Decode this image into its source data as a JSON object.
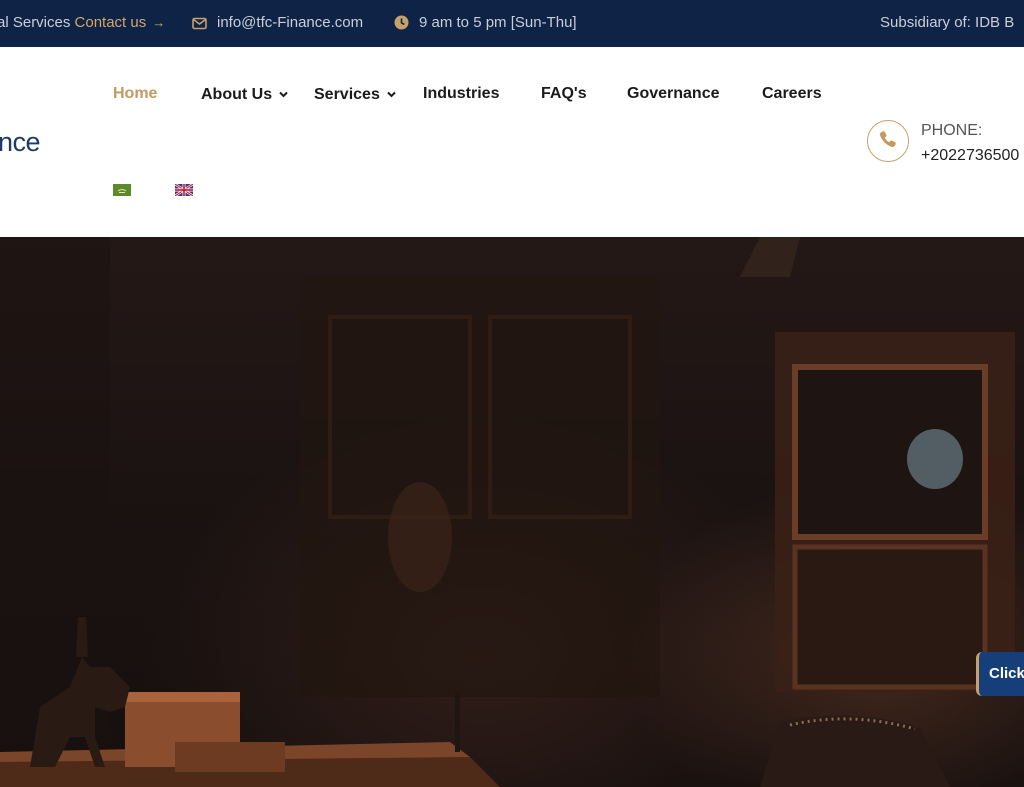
{
  "topbar": {
    "services_text": "al Services",
    "contact_label": "Contact us",
    "contact_arrow": "→",
    "email": "info@tfc-Finance.com",
    "hours": "9 am to 5 pm [Sun-Thu]",
    "subsidiary": "Subsidiary of: IDB B"
  },
  "header": {
    "logo_text": "nce",
    "nav": [
      {
        "label": "Home",
        "active": true
      },
      {
        "label": "About Us",
        "dropdown": true
      },
      {
        "label": "Services",
        "dropdown": true
      },
      {
        "label": "Industries"
      },
      {
        "label": "FAQ's"
      },
      {
        "label": "Governance"
      },
      {
        "label": "Careers"
      }
    ],
    "languages": [
      "arabic-flag",
      "uk-flag"
    ],
    "phone_label": "PHONE:",
    "phone_number": "+2022736500"
  },
  "hero": {
    "click_tab_label": "Click"
  },
  "colors": {
    "topbar_bg": "#0e2345",
    "accent_gold": "#c29a62",
    "logo_blue": "#1d3b6a",
    "click_tab_bg": "#163f7a"
  }
}
